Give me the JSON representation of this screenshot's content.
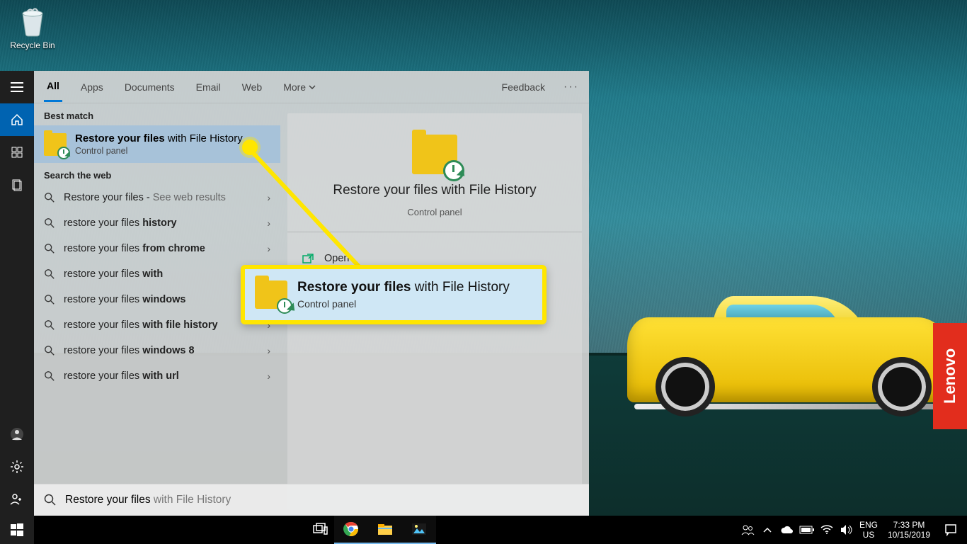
{
  "desktop": {
    "recycle_bin_label": "Recycle Bin",
    "lenovo_label": "Lenovo"
  },
  "start_rail": {
    "items": [
      "menu",
      "home",
      "explore",
      "documents"
    ],
    "bottom": [
      "user",
      "settings",
      "power"
    ]
  },
  "search": {
    "tabs": [
      "All",
      "Apps",
      "Documents",
      "Email",
      "Web",
      "More"
    ],
    "feedback_label": "Feedback",
    "best_match_label": "Best match",
    "best_match": {
      "title_bold": "Restore your files",
      "title_rest": " with File History",
      "subtitle": "Control panel"
    },
    "web_label": "Search the web",
    "web_results": [
      {
        "prefix": "Restore your files",
        "bold": "",
        "suffix": " - ",
        "hint": "See web results"
      },
      {
        "prefix": "restore your files ",
        "bold": "history",
        "suffix": "",
        "hint": ""
      },
      {
        "prefix": "restore your files ",
        "bold": "from chrome",
        "suffix": "",
        "hint": ""
      },
      {
        "prefix": "restore your files ",
        "bold": "with",
        "suffix": "",
        "hint": ""
      },
      {
        "prefix": "restore your files ",
        "bold": "windows",
        "suffix": "",
        "hint": ""
      },
      {
        "prefix": "restore your files ",
        "bold": "with file history",
        "suffix": "",
        "hint": ""
      },
      {
        "prefix": "restore your files ",
        "bold": "windows 8",
        "suffix": "",
        "hint": ""
      },
      {
        "prefix": "restore your files ",
        "bold": "with url",
        "suffix": "",
        "hint": ""
      }
    ],
    "detail": {
      "title": "Restore your files with File History",
      "subtitle": "Control panel",
      "open_label": "Open"
    },
    "input": {
      "typed": "Restore your files",
      "ghost": " with File History"
    }
  },
  "callout": {
    "title_bold": "Restore your files",
    "title_rest": " with File History",
    "subtitle": "Control panel"
  },
  "taskbar": {
    "apps": [
      "taskview",
      "chrome",
      "explorer",
      "photos"
    ],
    "lang_top": "ENG",
    "lang_bottom": "US",
    "time": "7:33 PM",
    "date": "10/15/2019"
  }
}
